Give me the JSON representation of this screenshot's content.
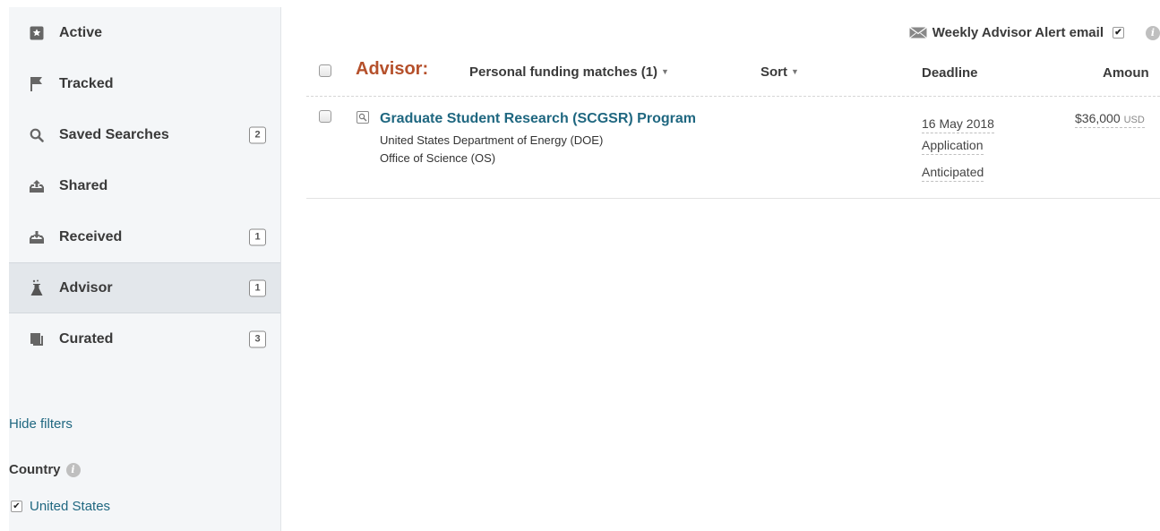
{
  "sidebar": {
    "items": [
      {
        "label": "Active",
        "icon": "star-icon",
        "badge": null
      },
      {
        "label": "Tracked",
        "icon": "flag-icon",
        "badge": null
      },
      {
        "label": "Saved Searches",
        "icon": "search-icon",
        "badge": "2"
      },
      {
        "label": "Shared",
        "icon": "tray-upload-icon",
        "badge": null
      },
      {
        "label": "Received",
        "icon": "tray-download-icon",
        "badge": "1"
      },
      {
        "label": "Advisor",
        "icon": "flask-icon",
        "badge": "1",
        "active": true
      },
      {
        "label": "Curated",
        "icon": "documents-icon",
        "badge": "3"
      }
    ],
    "hide_filters": "Hide filters",
    "country_label": "Country",
    "country_option": "United States",
    "country_checked": true
  },
  "alert": {
    "label": "Weekly Advisor Alert email",
    "checked": true
  },
  "header": {
    "title": "Advisor:",
    "matches": "Personal funding matches (1)",
    "sort": "Sort",
    "deadline": "Deadline",
    "amount": "Amoun"
  },
  "results": [
    {
      "title": "Graduate Student Research (SCGSR) Program",
      "sponsor": "United States Department of Energy (DOE)",
      "sub_sponsor": "Office of Science (OS)",
      "deadline_date": "16 May 2018",
      "deadline_type": "Application",
      "deadline_status": "Anticipated",
      "amount": "$36,000",
      "currency": "USD"
    }
  ],
  "colors": {
    "accent_title": "#b5502b",
    "link": "#1f6780",
    "sidebar_bg": "#f4f6f8"
  }
}
